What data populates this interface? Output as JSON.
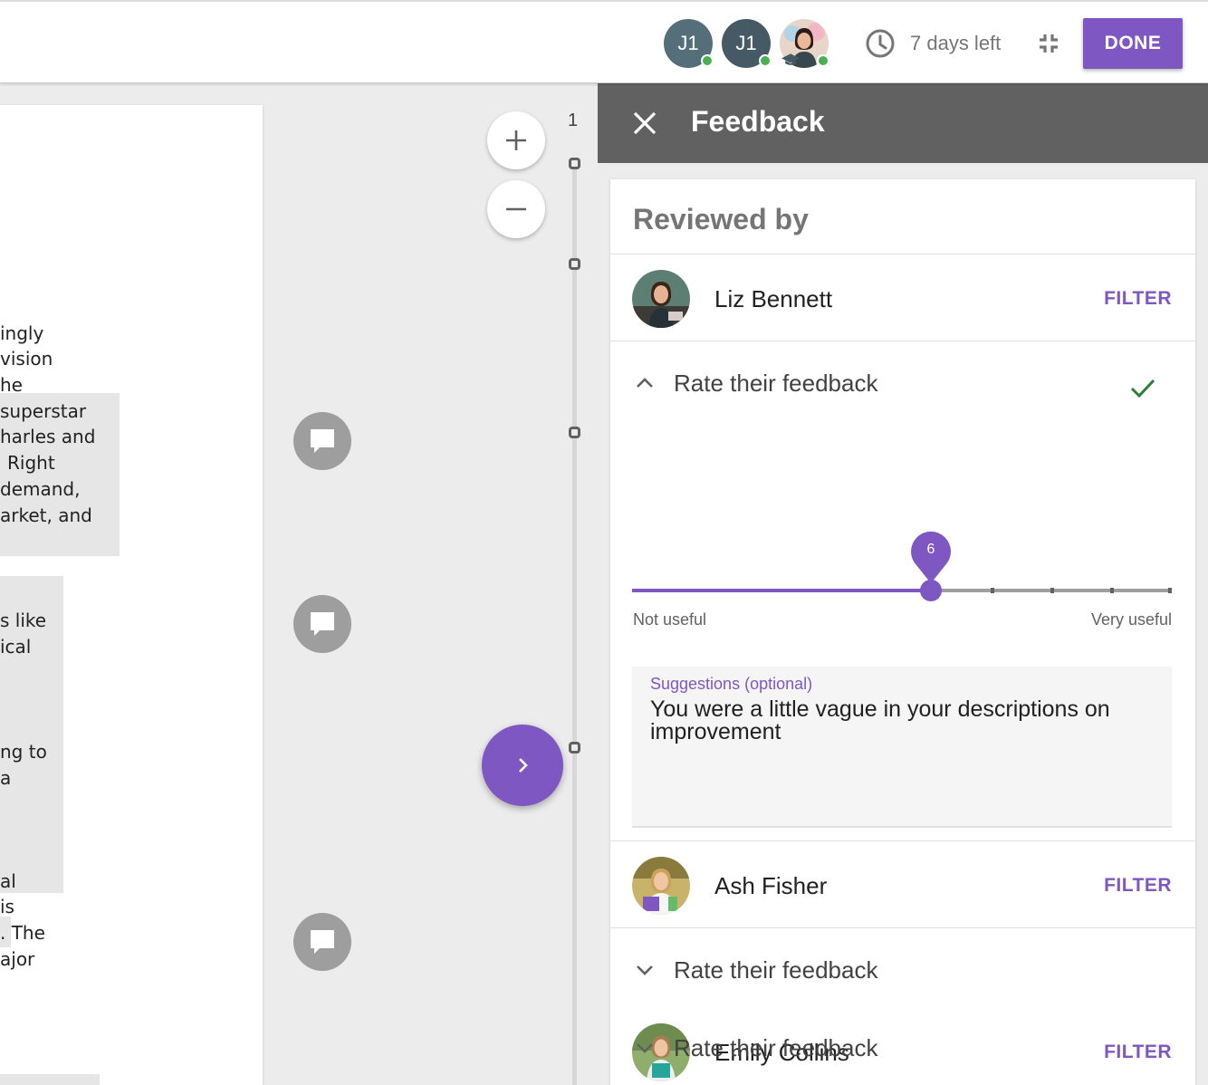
{
  "topbar": {
    "users": [
      {
        "initials": "J1",
        "color": "#546e7a"
      },
      {
        "initials": "J1",
        "color": "#455a64"
      },
      {
        "initials": "",
        "color": "#b0bec5"
      }
    ],
    "time_left": "7 days left",
    "done_label": "DONE"
  },
  "document": {
    "lines": [
      "ingly",
      "vision",
      "he",
      "superstar",
      "harles and",
      "Right",
      "demand,",
      "arket, and",
      "s like",
      "ical",
      "ng to",
      "a",
      "al",
      "is",
      ".  The",
      "ajor"
    ]
  },
  "scrubber": {
    "page_number": "1"
  },
  "panel": {
    "title": "Feedback",
    "reviewed_by": "Reviewed by",
    "reviewers": [
      {
        "name": "Liz Bennett",
        "filter": "FILTER",
        "rate_label": "Rate their feedback"
      },
      {
        "name": "Ash Fisher",
        "filter": "FILTER",
        "rate_label": "Rate their feedback"
      },
      {
        "name": "Emily Collins",
        "filter": "FILTER",
        "rate_label": "Rate their feedback"
      }
    ],
    "rating": {
      "value": "6",
      "min_label": "Not useful",
      "max_label": "Very useful",
      "fraction": 0.556
    },
    "suggestions": {
      "label": "Suggestions (optional)",
      "value": "You were a little vague in your descriptions on improvement"
    }
  },
  "colors": {
    "accent": "#7e57c2",
    "header": "#616161",
    "online": "#4caf50",
    "check": "#2e7d32"
  }
}
